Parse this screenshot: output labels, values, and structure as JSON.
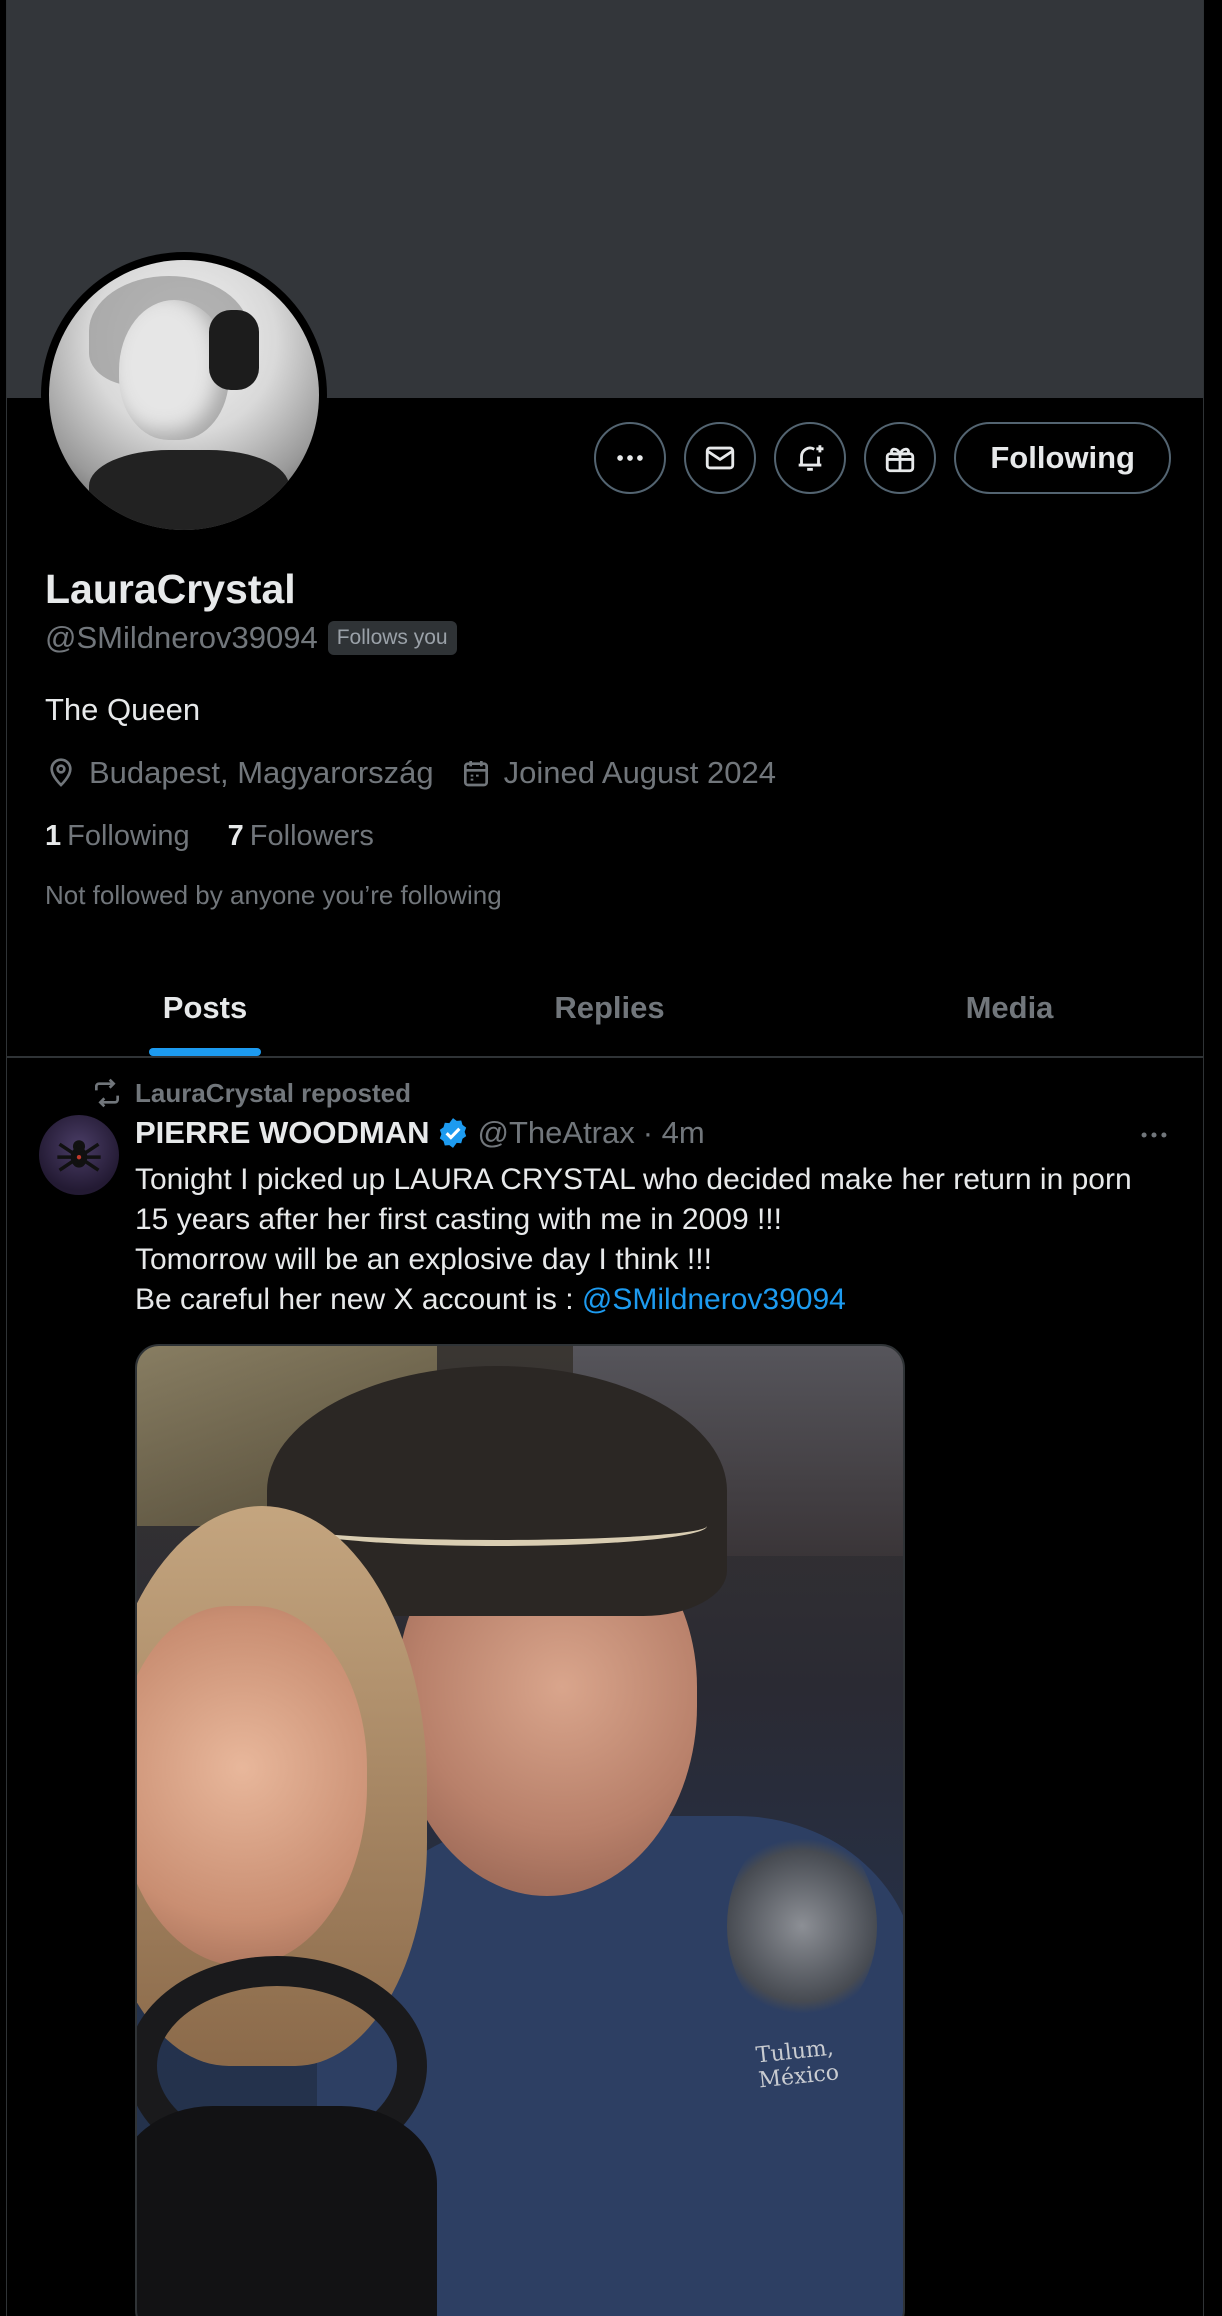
{
  "profile": {
    "display_name": "LauraCrystal",
    "handle": "@SMildnerov39094",
    "follows_you_badge": "Follows you",
    "bio": "The Queen",
    "location": "Budapest, Magyarország",
    "joined": "Joined August 2024",
    "following_count": "1",
    "following_label": "Following",
    "followers_count": "7",
    "followers_label": "Followers",
    "not_followed_note": "Not followed by anyone you’re following"
  },
  "actions": {
    "follow_button_label": "Following",
    "icons": [
      "more-icon",
      "message-icon",
      "notify-icon",
      "gift-icon"
    ]
  },
  "tabs": [
    {
      "label": "Posts",
      "active": true
    },
    {
      "label": "Replies",
      "active": false
    },
    {
      "label": "Media",
      "active": false
    }
  ],
  "post": {
    "repost_label": "LauraCrystal reposted",
    "author_name": "PIERRE WOODMAN",
    "author_handle": "@TheAtrax",
    "time": "· 4m",
    "text_line1": "Tonight I picked up LAURA CRYSTAL who decided make her return in porn",
    "text_line2": "15 years after her first casting with me in 2009 !!!",
    "text_line3": "Tomorrow will be an explosive day I think !!!",
    "text_line4_prefix": "Be careful her new X account is : ",
    "text_mention": "@SMildnerov39094",
    "image_caption_shirt": "Tulum, México"
  },
  "colors": {
    "accent": "#1d9bf0",
    "background": "#000000",
    "banner": "#33363a",
    "muted_text": "#71767b",
    "verified_badge": "#1d9bf0"
  }
}
